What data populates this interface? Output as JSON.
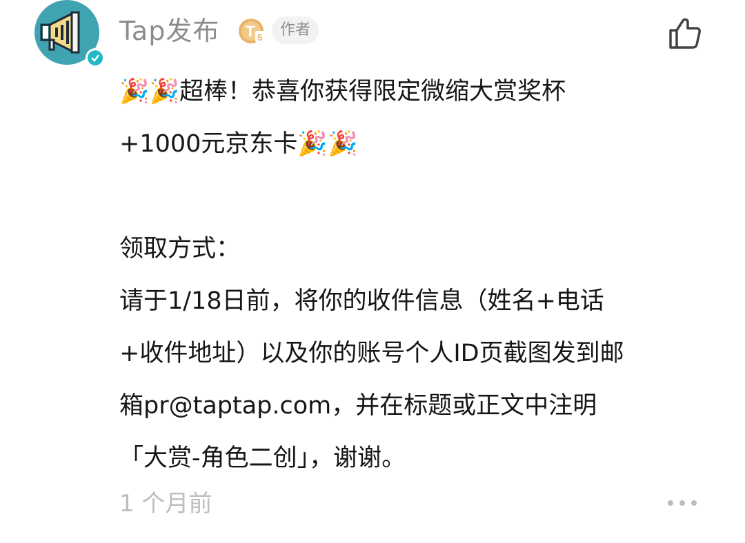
{
  "comment": {
    "author": "Tap发布",
    "author_tag": "作者",
    "level_badge": "T5",
    "lines": [
      "🎉🎉超棒！恭喜你获得限定微缩大赏奖杯",
      "+1000元京东卡🎉🎉",
      "",
      "领取方式：",
      "请于1/18日前，将你的收件信息（姓名+电话",
      "+收件地址）以及你的账号个人ID页截图发到邮",
      "箱pr@taptap.com，并在标题或正文中注明",
      "「大赏-角色二创」，谢谢。"
    ],
    "timestamp": "1 个月前"
  },
  "icons": {
    "avatar": "megaphone-icon",
    "verified": "verified-check-icon",
    "like": "thumbs-up-icon",
    "more": "more-dots-icon"
  },
  "colors": {
    "avatar_bg": "#3fa3b2",
    "verified": "#22b8c8",
    "muted_text": "#8c8c8c",
    "timestamp": "#bdbdbd",
    "badge_gold": "#e8b36a"
  }
}
